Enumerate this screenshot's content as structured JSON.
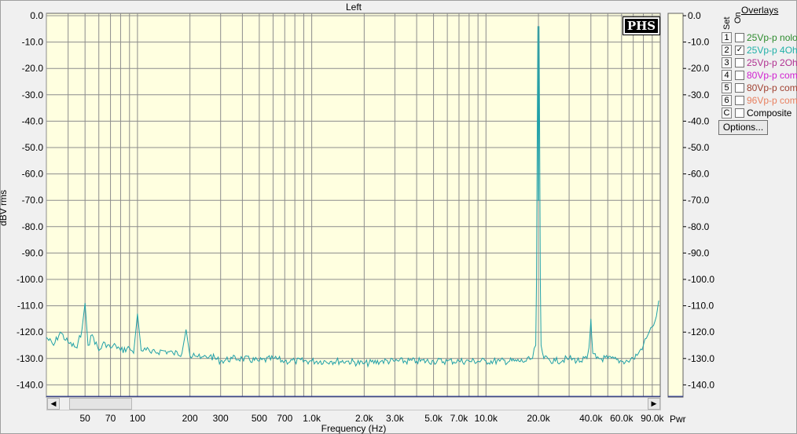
{
  "window": {
    "title": "Left"
  },
  "logo": "PHS",
  "right_axis_extra_label": "Pwr",
  "overlays": {
    "title": "Overlays",
    "col_set": "Set",
    "col_on": "On",
    "items": [
      {
        "num": "1",
        "checked": false,
        "label": "25Vp-p nolo",
        "color": "#2e8b2e"
      },
      {
        "num": "2",
        "checked": true,
        "label": "25Vp-p 4Oh",
        "color": "#20b0a8"
      },
      {
        "num": "3",
        "checked": false,
        "label": "25Vp-p 2Oh",
        "color": "#b03090"
      },
      {
        "num": "4",
        "checked": false,
        "label": "80Vp-p com",
        "color": "#d020d0"
      },
      {
        "num": "5",
        "checked": false,
        "label": "80Vp-p com",
        "color": "#a04030"
      },
      {
        "num": "6",
        "checked": false,
        "label": "96Vp-p com",
        "color": "#e88060"
      },
      {
        "num": "C",
        "checked": false,
        "label": "Composite",
        "color": "#000000"
      }
    ],
    "options_label": "Options..."
  },
  "colors": {
    "plot_bg": "#ffffe0",
    "grid": "#8c8c8c",
    "trace": "#20a0a8",
    "axis_line": "#2030a0"
  },
  "chart_data": {
    "type": "line",
    "title": "Left",
    "xlabel": "Frequency (Hz)",
    "ylabel": "dBV rms",
    "xscale": "log",
    "xlim": [
      30,
      100000
    ],
    "ylim": [
      -145,
      0
    ],
    "x_tick_labels": [
      {
        "value": 50,
        "label": "50"
      },
      {
        "value": 70,
        "label": "70"
      },
      {
        "value": 100,
        "label": "100"
      },
      {
        "value": 200,
        "label": "200"
      },
      {
        "value": 300,
        "label": "300"
      },
      {
        "value": 500,
        "label": "500"
      },
      {
        "value": 700,
        "label": "700"
      },
      {
        "value": 1000,
        "label": "1.0k"
      },
      {
        "value": 2000,
        "label": "2.0k"
      },
      {
        "value": 3000,
        "label": "3.0k"
      },
      {
        "value": 5000,
        "label": "5.0k"
      },
      {
        "value": 7000,
        "label": "7.0k"
      },
      {
        "value": 10000,
        "label": "10.0k"
      },
      {
        "value": 20000,
        "label": "20.0k"
      },
      {
        "value": 40000,
        "label": "40.0k"
      },
      {
        "value": 60000,
        "label": "60.0k"
      },
      {
        "value": 90000,
        "label": "90.0k"
      }
    ],
    "y_ticks": [
      0,
      -10,
      -20,
      -30,
      -40,
      -50,
      -60,
      -70,
      -80,
      -90,
      -100,
      -110,
      -120,
      -130,
      -140
    ],
    "y_tick_labels": [
      "0.0",
      "-10.0",
      "-20.0",
      "-30.0",
      "-40.0",
      "-50.0",
      "-60.0",
      "-70.0",
      "-80.0",
      "-90.0",
      "-100.0",
      "-110.0",
      "-120.0",
      "-130.0",
      "-140.0"
    ],
    "grid": true,
    "series": [
      {
        "x": [
          30,
          33,
          36,
          40,
          45,
          48,
          50,
          52,
          55,
          60,
          65,
          70,
          75,
          80,
          90,
          95,
          100,
          105,
          110,
          120,
          140,
          160,
          180,
          190,
          200,
          210,
          230,
          260,
          300,
          350,
          400,
          500,
          600,
          700,
          800,
          1000,
          1300,
          1600,
          2000,
          2500,
          3000,
          4000,
          5000,
          6000,
          7000,
          8000,
          10000,
          12000,
          15000,
          17000,
          18500,
          19300,
          19500,
          19700,
          19850,
          19950,
          20050,
          20150,
          20300,
          20500,
          20700,
          21500,
          25000,
          30000,
          35000,
          38000,
          39000,
          39600,
          40000,
          40400,
          41000,
          43000,
          50000,
          60000,
          65000,
          70000,
          75000,
          80000,
          85000,
          90000,
          95000,
          98000
        ],
        "y": [
          -122,
          -125,
          -120,
          -124,
          -126,
          -119,
          -109,
          -125,
          -121,
          -127,
          -124,
          -126,
          -125,
          -127,
          -126,
          -128,
          -113,
          -127,
          -126,
          -128,
          -127,
          -128,
          -128,
          -119,
          -129,
          -128,
          -130,
          -129,
          -131,
          -130,
          -130,
          -131,
          -130,
          -131,
          -131,
          -131,
          -131,
          -131,
          -132,
          -131,
          -131,
          -131,
          -131,
          -131,
          -131,
          -131,
          -131,
          -131,
          -131,
          -131,
          -130,
          -125,
          -100,
          -40,
          -4,
          -70,
          -70,
          -4,
          -40,
          -100,
          -125,
          -130,
          -131,
          -130,
          -131,
          -130,
          -126,
          -120,
          -115,
          -121,
          -128,
          -130,
          -130,
          -131,
          -131,
          -130,
          -128,
          -125,
          -121,
          -118,
          -114,
          -108
        ]
      }
    ]
  }
}
